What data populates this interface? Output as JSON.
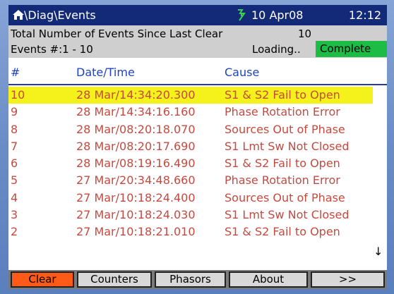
{
  "titlebar": {
    "home_icon": "home-icon",
    "path": "\\Diag\\Events",
    "signal_icon": "signal-icon",
    "date": "10 Apr08",
    "time": "12:12"
  },
  "summary": {
    "total_label": "Total Number of Events Since Last Clear",
    "total_value": "10",
    "range": "Events #:1 - 10",
    "loading": "Loading..",
    "status": "Complete"
  },
  "table": {
    "headers": [
      "#",
      "Date/Time",
      "Cause"
    ],
    "rows": [
      {
        "num": "10",
        "datetime": "28 Mar/14:34:20.300",
        "cause": "S1 & S2 Fail to Open"
      },
      {
        "num": "9",
        "datetime": "28 Mar/14:34:16.160",
        "cause": "Phase Rotation Error"
      },
      {
        "num": "8",
        "datetime": "28 Mar/08:20:18.070",
        "cause": "Sources Out of Phase"
      },
      {
        "num": "7",
        "datetime": "28 Mar/08:20:17.690",
        "cause": "S1 Lmt Sw Not Closed"
      },
      {
        "num": "6",
        "datetime": "28 Mar/08:19:16.490",
        "cause": "S1 & S2 Fail to Open"
      },
      {
        "num": "5",
        "datetime": "27 Mar/20:34:48.660",
        "cause": "Phase Rotation Error"
      },
      {
        "num": "4",
        "datetime": "27 Mar/10:18:24.400",
        "cause": "Sources Out of Phase"
      },
      {
        "num": "3",
        "datetime": "27 Mar/10:18:24.030",
        "cause": "S1 Lmt Sw Not Closed"
      },
      {
        "num": "2",
        "datetime": "27 Mar/10:18:21.010",
        "cause": "S1 & S2 Fail to Open"
      }
    ],
    "selected_index": 0,
    "scroll_arrow": "↓"
  },
  "buttons": [
    "Clear",
    "Counters",
    "Phasors",
    "About",
    ">>"
  ],
  "colors": {
    "titlebar_bg": "#132a78",
    "selected_row": "#f4f21a",
    "complete_badge": "#1cbc45",
    "active_button": "#ff5a18",
    "row_text": "#c44a3f",
    "header_text": "#1f43b8"
  }
}
